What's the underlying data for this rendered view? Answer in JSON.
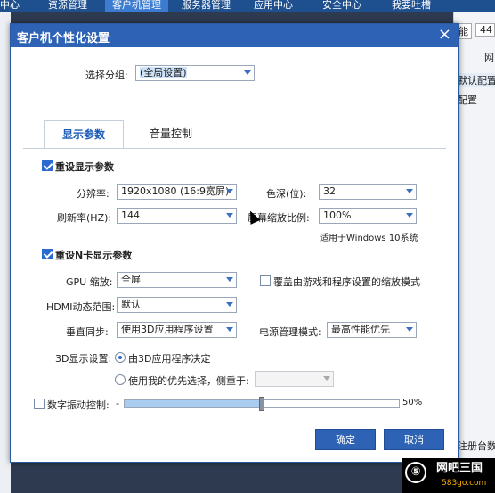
{
  "topnav": {
    "items": [
      "中心",
      "资源管理",
      "客户机管理",
      "服务器管理",
      "应用中心",
      "安全中心",
      "我要吐槽"
    ],
    "active_index": 2
  },
  "bg_right": {
    "top_select": "能",
    "top_number": "44",
    "col_a": "网",
    "cell1": "默认配置",
    "cell2": "配置",
    "bottom": "注册台数"
  },
  "dialog": {
    "title": "客户机个性化设置",
    "close": "×",
    "group_label": "选择分组:",
    "group_value": "(全局设置)",
    "tabs": [
      "显示参数",
      "音量控制"
    ],
    "active_tab": 0,
    "section1": {
      "label": "重设显示参数",
      "checked": true
    },
    "resolution": {
      "label": "分辨率:",
      "value": "1920x1080 (16:9宽屏)"
    },
    "color_depth": {
      "label": "色深(位):",
      "value": "32"
    },
    "refresh": {
      "label": "刷新率(HZ):",
      "value": "144"
    },
    "scale": {
      "label": "屏幕缩放比例:",
      "value": "100%"
    },
    "scale_note": "适用于Windows 10系统",
    "section2": {
      "label": "重设N卡显示参数",
      "checked": true
    },
    "gpu_scale": {
      "label": "GPU 缩放:",
      "value": "全屏"
    },
    "override": {
      "label": "覆盖由游戏和程序设置的缩放模式",
      "checked": false
    },
    "hdmi": {
      "label": "HDMI动态范围:",
      "value": "默认"
    },
    "vsync": {
      "label": "垂直同步:",
      "value": "使用3D应用程序设置"
    },
    "power": {
      "label": "电源管理模式:",
      "value": "最高性能优先"
    },
    "d3": {
      "label": "3D显示设置:",
      "option1": "由3D应用程序决定",
      "option2": "使用我的优先选择，侧重于:",
      "option2_value": "",
      "selected": 1
    },
    "vibrance": {
      "label": "数字振动控制:",
      "checked": false,
      "min": "-",
      "value_pct": 0.5,
      "value_text": "50%"
    },
    "ok": "确定",
    "cancel": "取消"
  },
  "watermark": {
    "brand": "网吧三国",
    "url": "583go.com",
    "icon": "⑤"
  }
}
